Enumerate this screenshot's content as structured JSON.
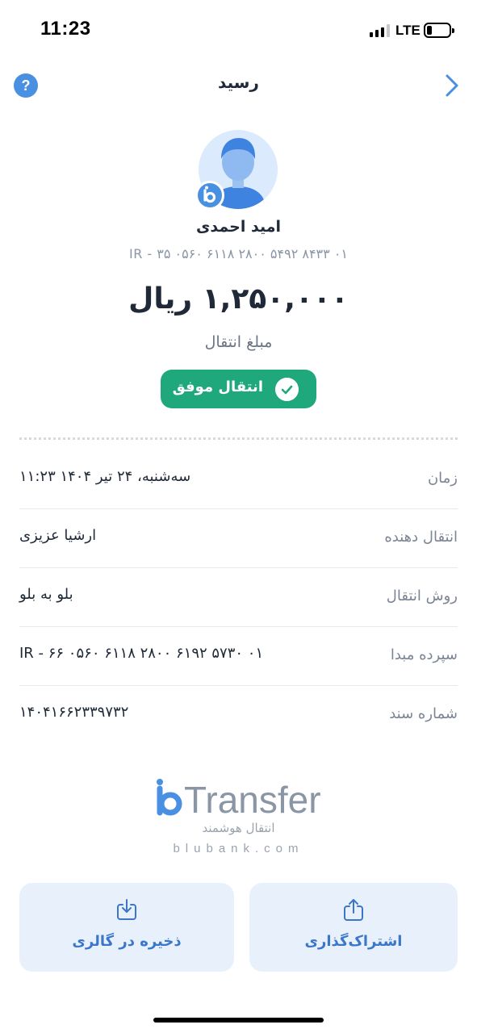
{
  "status_bar": {
    "time": "11:23",
    "network": "LTE"
  },
  "nav": {
    "title": "رسید",
    "help_icon": "help-icon",
    "back_icon": "chevron-right-icon"
  },
  "recipient": {
    "name": "امید احمدی",
    "iban": "IR - ۳۵ ۰۵۶۰ ۶۱۱۸ ۲۸۰۰ ۵۴۹۲ ۸۴۳۳ ۰۱"
  },
  "transfer": {
    "amount": "۱,۲۵۰,۰۰۰ ریال",
    "amount_label": "مبلغ انتقال",
    "status": "انتقال موفق",
    "status_color": "#1fa87c"
  },
  "details": [
    {
      "label": "زمان",
      "value": "۱۱:۲۳ سه‌شنبه، ۲۴ تیر ۱۴۰۴"
    },
    {
      "label": "انتقال دهنده",
      "value": "ارشیا عزیزی"
    },
    {
      "label": "روش انتقال",
      "value": "بلو به بلو"
    },
    {
      "label": "سپرده مبدا",
      "value": "IR - ۶۶ ۰۵۶۰ ۶۱۱۸ ۲۸۰۰ ۶۱۹۲ ۵۷۳۰ ۰۱"
    },
    {
      "label": "شماره سند",
      "value": "۱۴۰۴۱۶۶۲۳۳۹۷۳۲"
    }
  ],
  "brand": {
    "logo_text": "Transfer",
    "tagline": "انتقال هوشمند",
    "domain": "blubank.com",
    "accent": "#4a90e2"
  },
  "actions": {
    "save_label": "ذخیره در گالری",
    "share_label": "اشتراک‌گذاری"
  }
}
